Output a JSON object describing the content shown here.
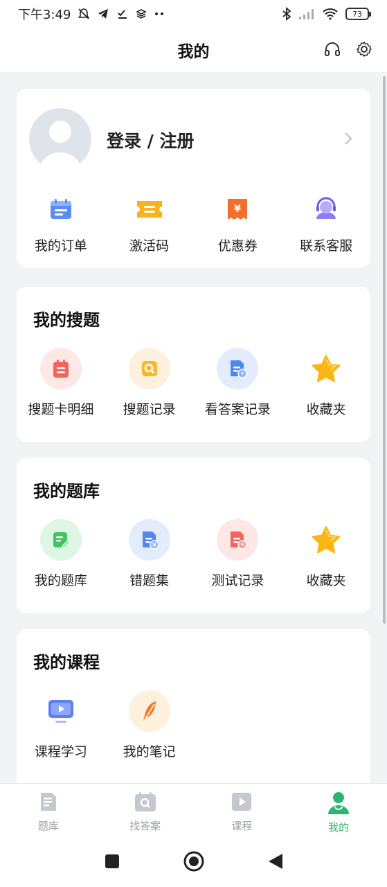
{
  "status_bar": {
    "time": "下午3:49",
    "battery": "73"
  },
  "header": {
    "title": "我的"
  },
  "profile": {
    "login_label": "登录 / 注册",
    "shortcuts": [
      {
        "label": "我的订单",
        "icon": "order-icon"
      },
      {
        "label": "激活码",
        "icon": "activation-code-icon"
      },
      {
        "label": "优惠券",
        "icon": "coupon-icon"
      },
      {
        "label": "联系客服",
        "icon": "customer-service-icon"
      }
    ]
  },
  "search_section": {
    "title": "我的搜题",
    "items": [
      {
        "label": "搜题卡明细",
        "icon": "search-card-icon"
      },
      {
        "label": "搜题记录",
        "icon": "search-record-icon"
      },
      {
        "label": "看答案记录",
        "icon": "answer-record-icon"
      },
      {
        "label": "收藏夹",
        "icon": "star-icon"
      }
    ]
  },
  "bank_section": {
    "title": "我的题库",
    "items": [
      {
        "label": "我的题库",
        "icon": "edit-note-icon"
      },
      {
        "label": "错题集",
        "icon": "wrong-questions-icon"
      },
      {
        "label": "测试记录",
        "icon": "test-record-icon"
      },
      {
        "label": "收藏夹",
        "icon": "star-icon"
      }
    ]
  },
  "course_section": {
    "title": "我的课程",
    "items": [
      {
        "label": "课程学习",
        "icon": "video-play-icon"
      },
      {
        "label": "我的笔记",
        "icon": "feather-icon"
      }
    ]
  },
  "bottom_nav": [
    {
      "label": "题库",
      "icon": "question-bank-icon",
      "active": false
    },
    {
      "label": "找答案",
      "icon": "find-answer-icon",
      "active": false
    },
    {
      "label": "课程",
      "icon": "course-icon",
      "active": false
    },
    {
      "label": "我的",
      "icon": "profile-icon",
      "active": true
    }
  ],
  "colors": {
    "accent": "#2bb673",
    "inactive": "#9aa0a6",
    "background": "#f2f3f5"
  }
}
